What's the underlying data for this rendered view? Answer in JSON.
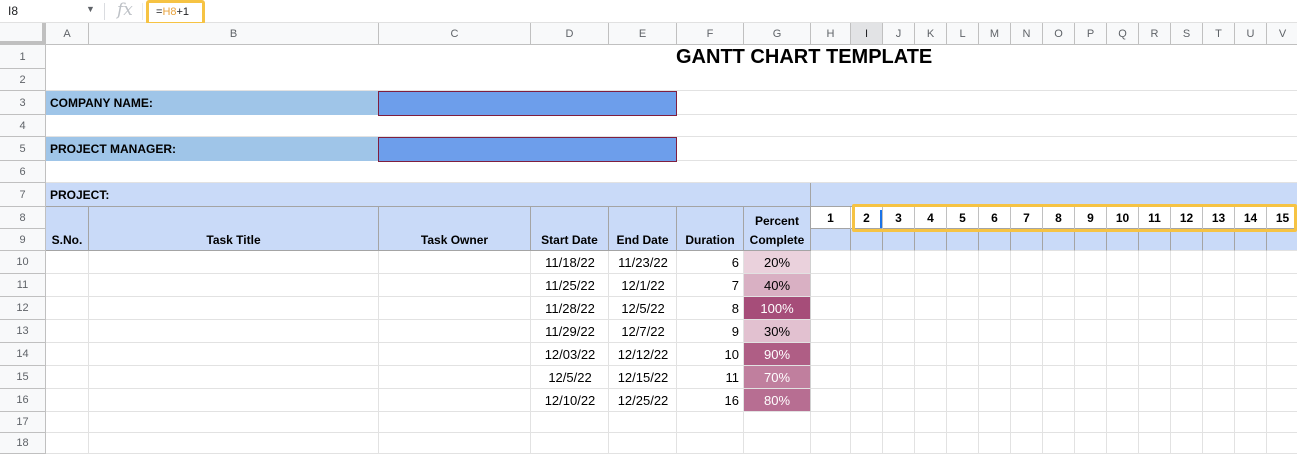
{
  "formula_bar": {
    "cell_ref": "I8",
    "fx_icon": "fx-icon",
    "formula_prefix": "=",
    "formula_ref": "H8",
    "formula_suffix": "+1"
  },
  "columns": [
    "A",
    "B",
    "C",
    "D",
    "E",
    "F",
    "G",
    "H",
    "I",
    "J",
    "K",
    "L",
    "M",
    "N",
    "O",
    "P",
    "Q",
    "R",
    "S",
    "T",
    "U",
    "V"
  ],
  "selected_column": "I",
  "rows": [
    "1",
    "2",
    "3",
    "4",
    "5",
    "6",
    "7",
    "8",
    "9",
    "10",
    "11",
    "12",
    "13",
    "14",
    "15",
    "16",
    "17",
    "18"
  ],
  "sheet": {
    "title": "GANTT CHART TEMPLATE",
    "company_label": "COMPANY NAME:",
    "manager_label": "PROJECT MANAGER:",
    "project_label": "PROJECT:",
    "table_headers": {
      "sno": "S.No.",
      "task_title": "Task Title",
      "task_owner": "Task Owner",
      "start_date": "Start Date",
      "end_date": "End Date",
      "duration": "Duration",
      "percent_line1": "Percent",
      "percent_line2": "Complete"
    },
    "tasks": [
      {
        "start": "11/18/22",
        "end": "11/23/22",
        "duration": "6",
        "percent": "20%",
        "percent_value": 0.2
      },
      {
        "start": "11/25/22",
        "end": "12/1/22",
        "duration": "7",
        "percent": "40%",
        "percent_value": 0.4
      },
      {
        "start": "11/28/22",
        "end": "12/5/22",
        "duration": "8",
        "percent": "100%",
        "percent_value": 1.0
      },
      {
        "start": "11/29/22",
        "end": "12/7/22",
        "duration": "9",
        "percent": "30%",
        "percent_value": 0.3
      },
      {
        "start": "12/03/22",
        "end": "12/12/22",
        "duration": "10",
        "percent": "90%",
        "percent_value": 0.9
      },
      {
        "start": "12/5/22",
        "end": "12/15/22",
        "duration": "11",
        "percent": "70%",
        "percent_value": 0.7
      },
      {
        "start": "12/10/22",
        "end": "12/25/22",
        "duration": "16",
        "percent": "80%",
        "percent_value": 0.8
      }
    ],
    "day_numbers": [
      "1",
      "2",
      "3",
      "4",
      "5",
      "6",
      "7",
      "8",
      "9",
      "10",
      "11",
      "12",
      "13",
      "14",
      "15"
    ]
  },
  "colors": {
    "header_band": "#c9daf8",
    "label_band": "#9fc5e8",
    "input_fill": "#6d9eeb",
    "highlight": "#f6c343",
    "percent_scale": [
      "#ead1dc",
      "#a64d79"
    ]
  }
}
